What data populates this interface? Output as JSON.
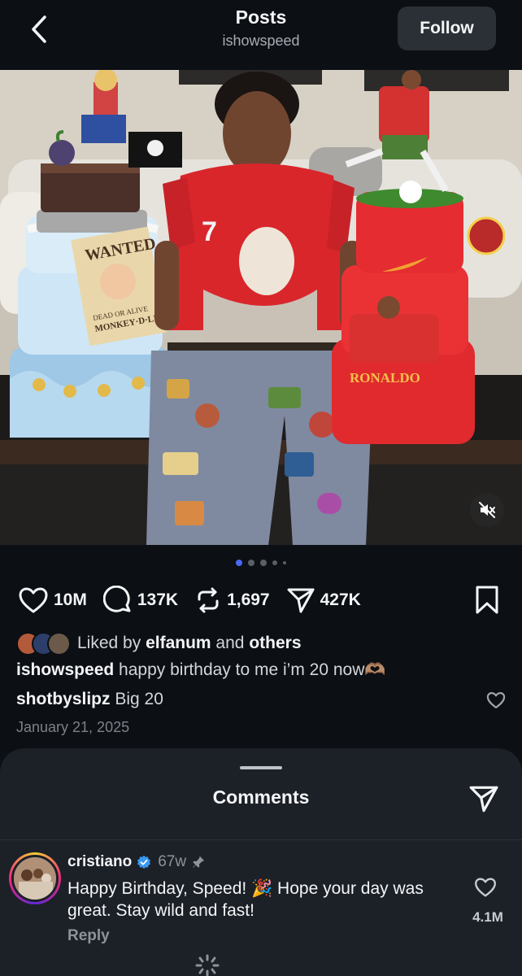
{
  "header": {
    "title": "Posts",
    "username": "ishowspeed",
    "follow_label": "Follow"
  },
  "media": {
    "description_icon": "muted-speaker-icon",
    "cake_left_poster": {
      "line1": "WANTED",
      "line2": "DEAD OR ALIVE",
      "line3": "MONKEY·D·LUFFY"
    },
    "shirt_number": "7",
    "cake_right_text": "RONALDO"
  },
  "carousel": {
    "count": 5,
    "active_index": 0
  },
  "actions": {
    "likes": "10M",
    "comments": "137K",
    "reposts": "1,697",
    "shares": "427K"
  },
  "liked_by": {
    "prefix": "Liked by",
    "user": "elfanum",
    "connector": "and",
    "others": "others"
  },
  "caption": {
    "user": "ishowspeed",
    "text": "happy birthday to me i’m 20 now🫶🏽"
  },
  "top_comment": {
    "user": "shotbyslipz",
    "text": "Big 20"
  },
  "date": "January 21, 2025",
  "comments_sheet": {
    "title": "Comments",
    "comment": {
      "user": "cristiano",
      "time": "67w",
      "text": "Happy Birthday, Speed! 🎉 Hope your day was great. Stay wild and fast!",
      "reply_label": "Reply",
      "like_count": "4.1M"
    }
  },
  "colors": {
    "background": "#0c0f14",
    "sheet": "#1c2027",
    "follow_button": "#2b3036",
    "active_dot": "#4a68f5",
    "verified": "#3897f0"
  }
}
